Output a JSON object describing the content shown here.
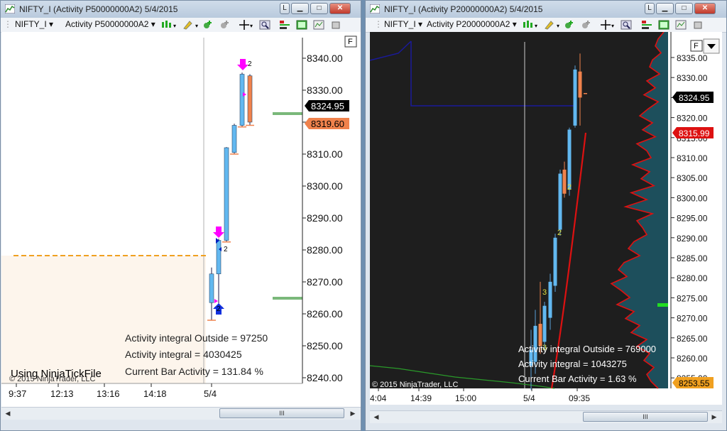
{
  "left": {
    "title": "NIFTY_I (Activity P50000000A2)  5/4/2015",
    "instrument": "NIFTY_I",
    "indicator": "Activity P50000000A2",
    "y_ticks": [
      "8340.00",
      "8330.00",
      "8320.00",
      "8310.00",
      "8300.00",
      "8290.00",
      "8280.00",
      "8270.00",
      "8260.00",
      "8250.00",
      "8240.00"
    ],
    "x_ticks": [
      "9:37",
      "12:13",
      "13:16",
      "14:18",
      "5/4"
    ],
    "last_price": "8324.95",
    "prev_price": "8319.60",
    "info": [
      "Activity integral Outside  = 97250",
      "Activity integral = 4030425",
      "Current Bar Activity = 131.84 %"
    ],
    "using": "Using NinjaTickFile",
    "copyright": "© 2015 NinjaTrader, LLC",
    "marker_labels": [
      "2",
      "2",
      "2"
    ],
    "f_label": "F",
    "scroll_grip": "III"
  },
  "right": {
    "title": "NIFTY_I (Activity P20000000A2)  5/4/2015",
    "instrument": "NIFTY_I",
    "indicator": "Activity P20000000A2",
    "y_ticks": [
      "8335.00",
      "8330.00",
      "8325.00",
      "8320.00",
      "8315.00",
      "8310.00",
      "8305.00",
      "8300.00",
      "8295.00",
      "8290.00",
      "8285.00",
      "8280.00",
      "8275.00",
      "8270.00",
      "8265.00",
      "8260.00",
      "8255.00"
    ],
    "x_ticks": [
      "4:04",
      "14:39",
      "15:00",
      "5/4",
      "09:35"
    ],
    "last_price": "8324.95",
    "red_price": "8315.99",
    "low_price": "8253.55",
    "info": [
      "Activity integral Outside  = 769000",
      "Activity integral = 1043275",
      "Current Bar Activity = 1.63 %"
    ],
    "copyright": "© 2015 NinjaTrader, LLC",
    "bar_labels": [
      "2",
      "2",
      "3",
      "3"
    ],
    "f_label": "F",
    "scroll_grip": "III"
  },
  "colors": {
    "up_bar": "#62b8f0",
    "down_bar": "#f0824c",
    "red_line": "#dd1111",
    "dashed": "#f0a020",
    "magenta": "#ff00ff"
  }
}
